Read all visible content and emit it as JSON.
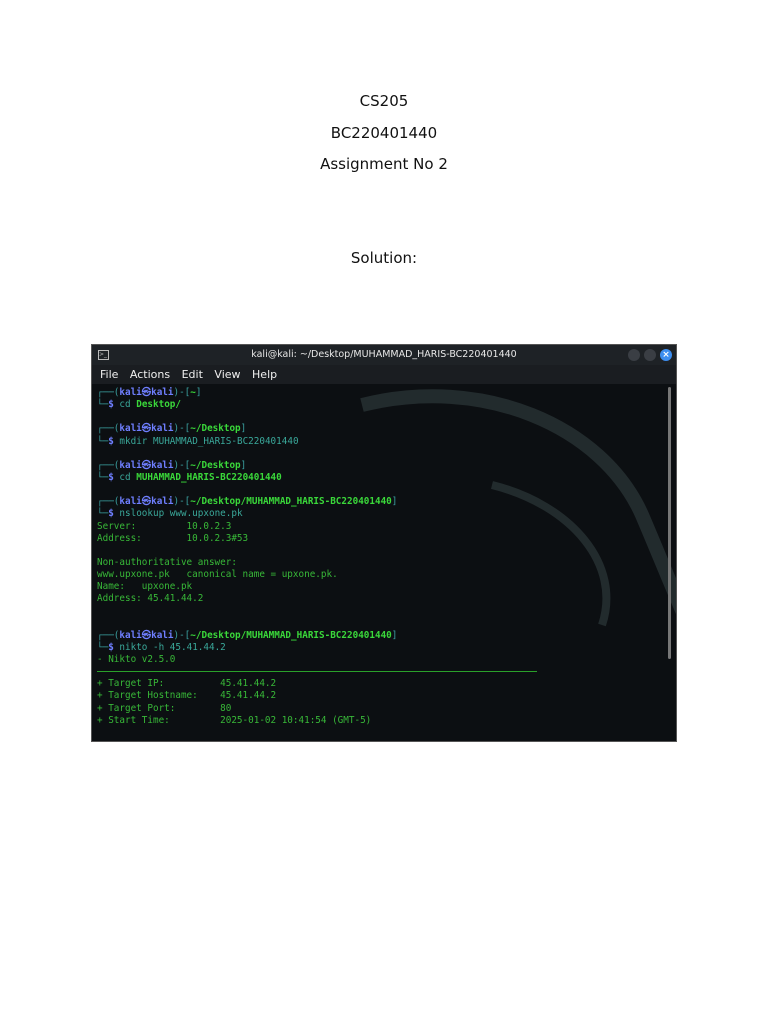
{
  "header": {
    "course": "CS205",
    "student_id": "BC220401440",
    "assignment": "Assignment No 2",
    "solution_label": "Solution:"
  },
  "terminal": {
    "title": "kali@kali: ~/Desktop/MUHAMMAD_HARIS-BC220401440",
    "menu": [
      "File",
      "Actions",
      "Edit",
      "View",
      "Help"
    ],
    "lines": [
      {
        "type": "prompt",
        "user": "kali",
        "host": "kali",
        "path": "~"
      },
      {
        "type": "cmd",
        "cmd": "cd",
        "args": "Desktop/",
        "bold": true
      },
      {
        "type": "blank"
      },
      {
        "type": "prompt",
        "user": "kali",
        "host": "kali",
        "path": "~/Desktop"
      },
      {
        "type": "cmd",
        "cmd": "mkdir",
        "args": "MUHAMMAD_HARIS-BC220401440",
        "bold": false
      },
      {
        "type": "blank"
      },
      {
        "type": "prompt",
        "user": "kali",
        "host": "kali",
        "path": "~/Desktop"
      },
      {
        "type": "cmd",
        "cmd": "cd",
        "args": "MUHAMMAD_HARIS-BC220401440",
        "bold": true
      },
      {
        "type": "blank"
      },
      {
        "type": "prompt",
        "user": "kali",
        "host": "kali",
        "path": "~/Desktop/MUHAMMAD_HARIS-BC220401440"
      },
      {
        "type": "cmd",
        "cmd": "nslookup",
        "args": "www.upxone.pk",
        "bold": false
      },
      {
        "type": "out",
        "text": "Server:         10.0.2.3"
      },
      {
        "type": "out",
        "text": "Address:        10.0.2.3#53"
      },
      {
        "type": "blank"
      },
      {
        "type": "out",
        "text": "Non-authoritative answer:"
      },
      {
        "type": "out",
        "text": "www.upxone.pk   canonical name = upxone.pk."
      },
      {
        "type": "out",
        "text": "Name:   upxone.pk"
      },
      {
        "type": "out",
        "text": "Address: 45.41.44.2"
      },
      {
        "type": "blank"
      },
      {
        "type": "blank"
      },
      {
        "type": "prompt",
        "user": "kali",
        "host": "kali",
        "path": "~/Desktop/MUHAMMAD_HARIS-BC220401440"
      },
      {
        "type": "cmd",
        "cmd": "nikto",
        "args": "-h 45.41.44.2",
        "bold": false
      },
      {
        "type": "out",
        "text": "- Nikto v2.5.0"
      },
      {
        "type": "rule"
      },
      {
        "type": "out",
        "text": "+ Target IP:          45.41.44.2"
      },
      {
        "type": "out",
        "text": "+ Target Hostname:    45.41.44.2"
      },
      {
        "type": "out",
        "text": "+ Target Port:        80"
      },
      {
        "type": "out",
        "text": "+ Start Time:         2025-01-02 10:41:54 (GMT-5)"
      }
    ]
  }
}
